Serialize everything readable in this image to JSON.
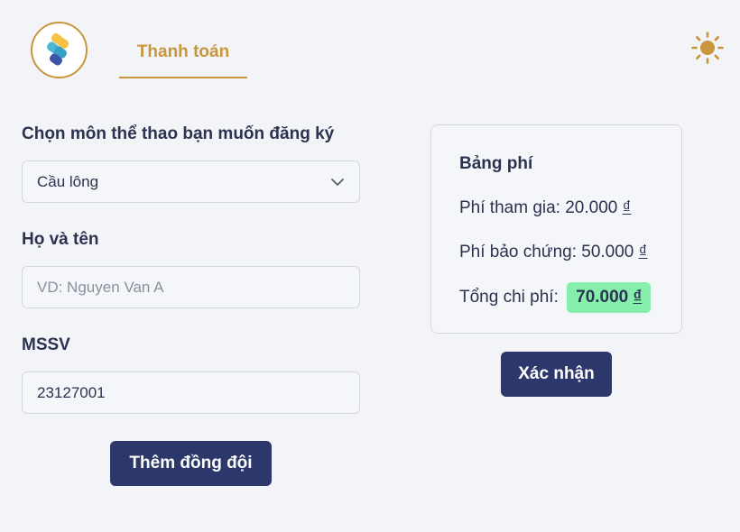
{
  "header": {
    "tabs": [
      {
        "label": "Thanh toán",
        "active": true
      }
    ],
    "theme_icon": "sun-icon",
    "logo_icon": "app-logo"
  },
  "form": {
    "sport": {
      "label": "Chọn môn thể thao bạn muốn đăng ký",
      "value": "Cầu lông"
    },
    "name": {
      "label": "Họ và tên",
      "placeholder": "VD: Nguyen Van A",
      "value": ""
    },
    "student_id": {
      "label": "MSSV",
      "value": "23127001"
    },
    "add_teammate_label": "Thêm đồng đội"
  },
  "fees": {
    "title": "Bảng phí",
    "participation_label": "Phí tham gia:",
    "participation_value": "20.000",
    "deposit_label": "Phí bảo chứng:",
    "deposit_value": "50.000",
    "total_label": "Tổng chi phí:",
    "total_value": "70.000",
    "currency": "₫"
  },
  "confirm_label": "Xác nhận",
  "colors": {
    "accent": "#c9963e",
    "primary_button": "#2c376b",
    "total_highlight": "#86efac",
    "background": "#f3f4f7"
  }
}
